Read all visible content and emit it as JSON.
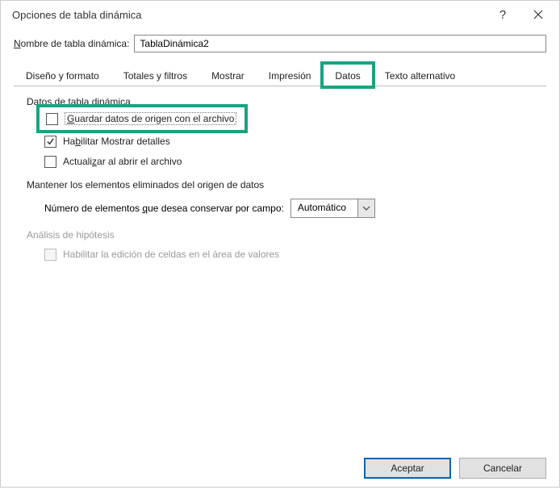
{
  "titlebar": {
    "title": "Opciones de tabla dinámica"
  },
  "name": {
    "label_pre": "N",
    "label_rest": "ombre de tabla dinámica:",
    "value": "TablaDinámica2"
  },
  "tabs": {
    "t0": "Diseño y formato",
    "t1": "Totales y filtros",
    "t2": "Mostrar",
    "t3": "Impresión",
    "t4": "Datos",
    "t5": "Texto alternativo"
  },
  "sections": {
    "s1": "Datos de tabla dinámica",
    "s2": "Mantener los elementos eliminados del origen de datos",
    "s3": "Análisis de hipótesis"
  },
  "checkboxes": {
    "c1_pre": "G",
    "c1_rest": "uardar datos de origen con el archivo",
    "c2_pre": "Ha",
    "c2_u": "b",
    "c2_rest": "ilitar Mostrar detalles",
    "c3_pre": "Actuali",
    "c3_u": "z",
    "c3_rest": "ar al abrir el archivo",
    "c4": "Habilitar la edición de celdas en el área de valores"
  },
  "dropdown": {
    "label_pre": "Número de elementos ",
    "label_u": "q",
    "label_rest": "ue desea conservar por campo:",
    "value": "Automático"
  },
  "footer": {
    "ok": "Aceptar",
    "cancel": "Cancelar"
  }
}
